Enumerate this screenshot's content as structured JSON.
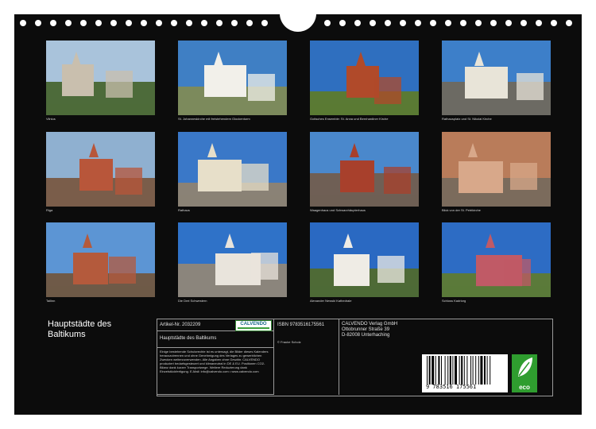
{
  "calendar_title": [
    "Hauptstädte des",
    "Baltikums"
  ],
  "photos": [
    {
      "caption": "Vilnius",
      "sky": "#a9c3db",
      "ground": "#4d6b3a",
      "accent": "#c9bfae"
    },
    {
      "caption": "St. Johanneskirche mit freistehendem Glockenturm",
      "sky": "#3f7fc4",
      "ground": "#7c8a5c",
      "accent": "#f2f0ea"
    },
    {
      "caption": "Gotisches Ensemble: St. Anna und Bernhardiner Kirche",
      "sky": "#2f6fbf",
      "ground": "#5a7a34",
      "accent": "#b04a2a"
    },
    {
      "caption": "Rathausplatz und St. Nikolai Kirche",
      "sky": "#3d7fc9",
      "ground": "#6c6a63",
      "accent": "#e8e4d8"
    },
    {
      "caption": "Riga",
      "sky": "#8fb0d0",
      "ground": "#7a5d4a",
      "accent": "#b8563a"
    },
    {
      "caption": "Rathaus",
      "sky": "#3a78c8",
      "ground": "#8a8276",
      "accent": "#e7dfc9"
    },
    {
      "caption": "Waagenhaus und Schwarzhäupterhaus",
      "sky": "#4a88cc",
      "ground": "#6f5f55",
      "accent": "#a8402c"
    },
    {
      "caption": "Blick von der St. Petrikirche",
      "sky": "#b97c5a",
      "ground": "#7b6b5c",
      "accent": "#d8a88a"
    },
    {
      "caption": "Tallinn",
      "sky": "#5c95d4",
      "ground": "#6f5a48",
      "accent": "#b45a3c"
    },
    {
      "caption": "Die Drei Schwestern",
      "sky": "#2f72c8",
      "ground": "#8b857c",
      "accent": "#e9e4dc"
    },
    {
      "caption": "Alexander Newski Kathedrale",
      "sky": "#2a69c2",
      "ground": "#4e6a36",
      "accent": "#efece5"
    },
    {
      "caption": "Schloss Kadriorg",
      "sky": "#2d6cc4",
      "ground": "#5b7a3a",
      "accent": "#c05a66"
    }
  ],
  "info": {
    "article": "Artikel-Nr. 2032209",
    "name": "Hauptstädte des Baltikums",
    "fineprint": "Einige bestehende Schutzrechte ist es untersagt, die Bilder dieses Kalenders herauszutrennen und ohne Genehmigung des Verlages zu gewerblichen Zwecken weiterzuverwenden. Alle Angaben ohne Gewähr. CALVENDO produziert bedarfsgesteuert und klimaneutral in DE & EU. Positionen CO2-Bilanz dank kurzer Transportwege. Weitere Reduzierung dank Einzelstückfertigung. E-Mail: info@calvendo.com • www.calvendo.com",
    "isbn": "ISBN 9783516175561",
    "author": "© Frauke Scholz",
    "publisher": [
      "CALVENDO Verlag GmbH",
      "Ottobrunner Straße 39",
      "D-82008 Unterhaching"
    ],
    "logo": "CALVENDO",
    "barcode_digits": "9  783516  175561",
    "eco_label": "eco",
    "colors": {
      "sheet": "#0c0c0c",
      "eco": "#2f9d2f"
    }
  }
}
